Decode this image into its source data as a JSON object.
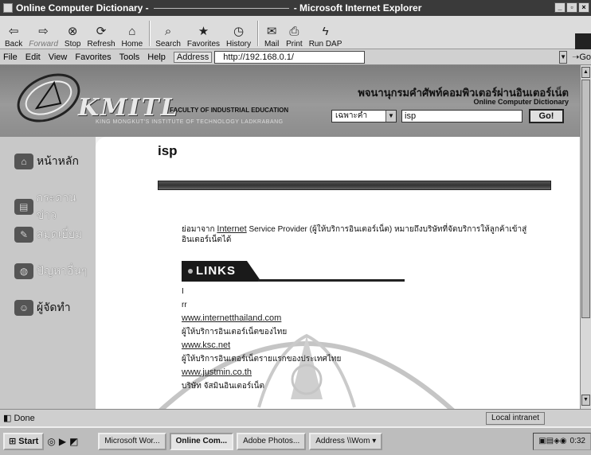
{
  "window": {
    "title": "Online Computer Dictionary -",
    "title_suffix": "- Microsoft Internet Explorer"
  },
  "toolbar": {
    "back": "Back",
    "forward": "Forward",
    "stop": "Stop",
    "refresh": "Refresh",
    "home": "Home",
    "search": "Search",
    "favorites": "Favorites",
    "history": "History",
    "mail": "Mail",
    "print": "Print",
    "run_dap": "Run DAP"
  },
  "menu": [
    "File",
    "Edit",
    "View",
    "Favorites",
    "Tools",
    "Help"
  ],
  "address": {
    "label": "Address",
    "value": "http://192.168.0.1/",
    "go": "Go"
  },
  "header": {
    "logo_text": "KMITL",
    "faculty": "FACULTY OF INDUSTRIAL EDUCATION",
    "institute": "KING MONGKUT'S INSTITUTE OF TECHNOLOGY LADKRABANG",
    "site_title_thai": "พจนานุกรมคำศัพท์คอมพิวเตอร์ผ่านอินเตอร์เน็ต",
    "site_title_en": "Online Computer Dictionary",
    "search_mode": "เฉพาะคำ",
    "search_value": "isp",
    "go_button": "Go!"
  },
  "sidebar": {
    "items": [
      {
        "label": "หน้าหลัก"
      },
      {
        "label": "กระดานข่าว"
      },
      {
        "label": "สมุดเยี่ยม"
      },
      {
        "label": "ปัญหาอื่นๆ"
      },
      {
        "label": "ผู้จัดทำ"
      }
    ]
  },
  "entry": {
    "term": "isp",
    "def_prefix": "ย่อมาจาก",
    "def_link": "Internet",
    "def_rest": " Service Provider (ผู้ให้บริการอินเตอร์เน็ต) หมายถึงบริษัทที่จัดบริการให้ลูกค้าเข้าสู่อินเตอร์เน็ตได้"
  },
  "links_section": {
    "heading": "LINKS",
    "lines": [
      {
        "text": "I",
        "is_url": false
      },
      {
        "text": "rr",
        "is_url": false
      },
      {
        "text": "www.internetthailand.com",
        "is_url": true
      },
      {
        "text": "ผู้ให้บริการอินเตอร์เน็ตของไทย",
        "is_url": false
      },
      {
        "text": "www.ksc.net",
        "is_url": true
      },
      {
        "text": "ผู้ให้บริการอินเตอร์เน็ตรายแรกของประเทศไทย",
        "is_url": false
      },
      {
        "text": "www.justmin.co.th",
        "is_url": true
      },
      {
        "text": "บริษัท จัสมินอินเตอร์เน็ต",
        "is_url": false
      }
    ]
  },
  "status": {
    "text": "Done",
    "zone": "Local intranet"
  },
  "taskbar": {
    "start": "Start",
    "tasks": [
      {
        "label": "Microsoft Wor...",
        "active": false
      },
      {
        "label": "Online Com...",
        "active": true
      },
      {
        "label": "Adobe Photos...",
        "active": false
      }
    ],
    "address_label": "Address",
    "address_value": "\\\\Wom",
    "clock": "0:32"
  }
}
